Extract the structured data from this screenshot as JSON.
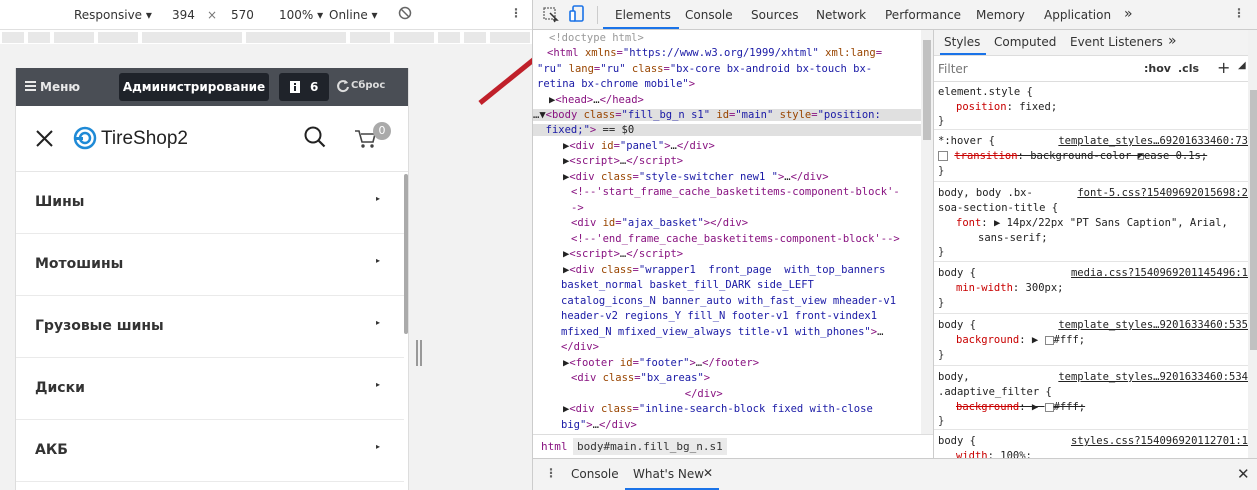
{
  "device_toolbar": {
    "mode": "Responsive",
    "width": "394",
    "times": "×",
    "height": "570",
    "zoom": "100%",
    "network": "Online"
  },
  "admin_bar": {
    "menu": "Меню",
    "admin": "Администрирование",
    "notifications": "6",
    "reset": "Сброс"
  },
  "site": {
    "logo": "TireShop2",
    "cart_count": "0"
  },
  "nav": [
    "Шины",
    "Мотошины",
    "Грузовые шины",
    "Диски",
    "АКБ"
  ],
  "devtools": {
    "tabs": [
      "Elements",
      "Console",
      "Sources",
      "Network",
      "Performance",
      "Memory",
      "Application",
      "»"
    ],
    "active_tab": "Elements",
    "breadcrumb": [
      "html",
      "body#main.fill_bg_n.s1"
    ],
    "styles_tabs": [
      "Styles",
      "Computed",
      "Event Listeners",
      "»"
    ],
    "filter_placeholder": "Filter",
    "filter_hov": ":hov",
    "filter_cls": ".cls",
    "drawer_tabs": [
      "Console",
      "What's New"
    ]
  },
  "colors": {
    "accent": "#1a73e8",
    "admin_bar": "#4a4e55",
    "logo_blue": "#1f8ad6",
    "arrow": "#c0202a"
  }
}
